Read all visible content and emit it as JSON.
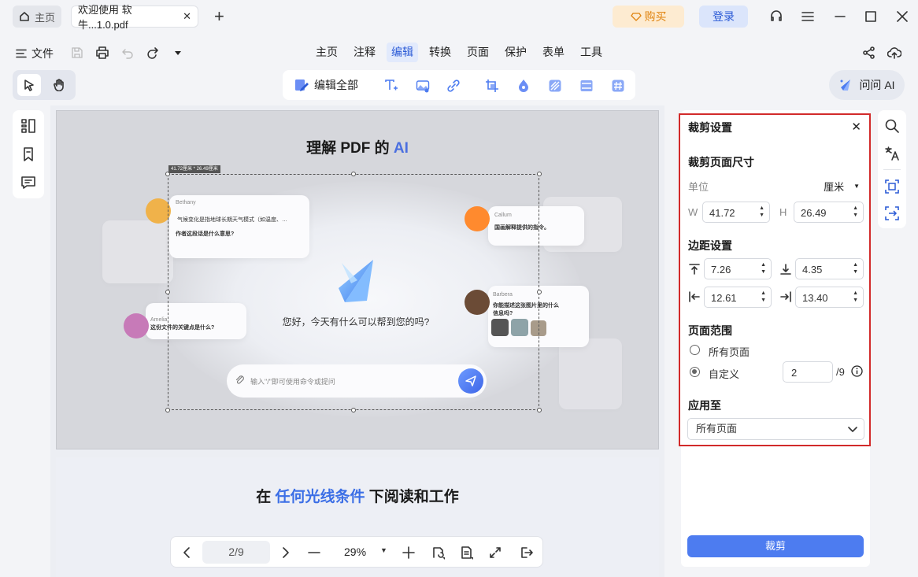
{
  "titlebar": {
    "home_tab": "主页",
    "doc_tab": "欢迎使用 软牛...1.0.pdf",
    "buy_label": "购买",
    "login_label": "登录"
  },
  "menubar": {
    "file_label": "文件",
    "items": [
      "主页",
      "注释",
      "编辑",
      "转换",
      "页面",
      "保护",
      "表单",
      "工具"
    ],
    "active_item": "编辑"
  },
  "edit_toolbar": {
    "edit_all_label": "编辑全部",
    "ask_ai_label": "问问 AI"
  },
  "document": {
    "page1": {
      "title_prefix": "理解 PDF 的 ",
      "title_highlight": "AI",
      "crop_size_tag": "41.72厘米 * 26.49厘米",
      "cards": [
        {
          "name": "Bethany",
          "text": "气候变化是指地球长期天气模式（如温度、…",
          "text2": "作者这段话是什么意思?"
        },
        {
          "name": "Callum",
          "text": "国画解释提供的指令。"
        },
        {
          "name": "Amelia",
          "text": "这份文件的关键点是什么?"
        },
        {
          "name": "Barbera",
          "text": "你能描述这张图片里的什么信息吗?"
        }
      ],
      "greeting": "您好，今天有什么可以帮到您的吗?",
      "input_placeholder": "输入\"/\"即可使用命令或提问"
    },
    "page2": {
      "title_before": "在 ",
      "title_highlight": "任何光线条件",
      "title_after": " 下阅读和工作"
    }
  },
  "bottom_toolbar": {
    "page_indicator": "2/9",
    "zoom": "29%"
  },
  "crop_panel": {
    "title": "裁剪设置",
    "size_section": "裁剪页面尺寸",
    "unit_label": "单位",
    "unit_value": "厘米",
    "width_label": "W",
    "width_value": "41.72",
    "height_label": "H",
    "height_value": "26.49",
    "margin_section": "边距设置",
    "margin_top": "7.26",
    "margin_bottom": "4.35",
    "margin_left": "12.61",
    "margin_right": "13.40",
    "range_section": "页面范围",
    "all_pages": "所有页面",
    "custom": "自定义",
    "custom_value": "2",
    "custom_total": "/9",
    "apply_section": "应用至",
    "apply_value": "所有页面",
    "crop_button": "裁剪"
  },
  "colors": {
    "accent": "#4d7cf0",
    "highlight_border": "#d22a2a",
    "buy_text": "#e0830f",
    "login_text": "#2c5bd6"
  }
}
